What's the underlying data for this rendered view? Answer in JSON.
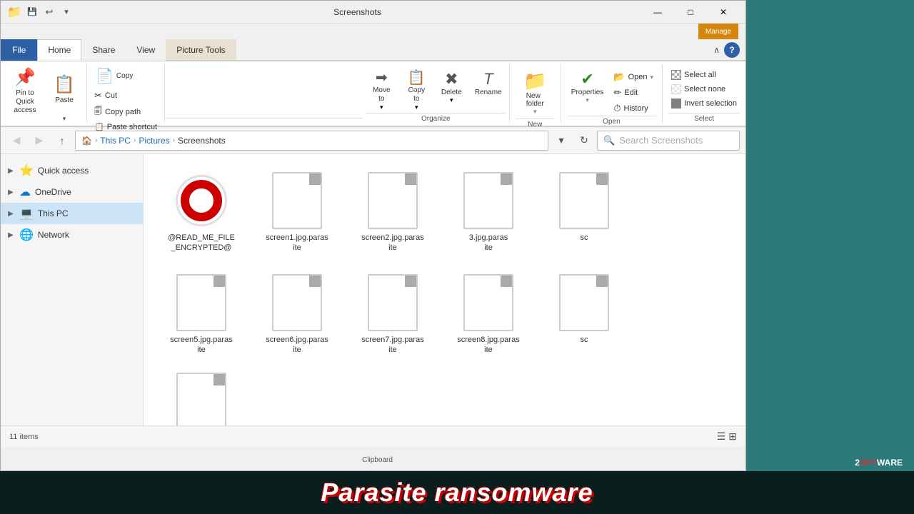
{
  "window": {
    "title": "Screenshots",
    "manage_label": "Manage",
    "picture_tools_label": "Picture Tools"
  },
  "titlebar": {
    "folder_icon": "📁",
    "quick_save_icon": "💾",
    "dropdown_label": "▾"
  },
  "window_controls": {
    "minimize": "—",
    "maximize": "□",
    "close": "✕"
  },
  "ribbon": {
    "tabs": {
      "file": "File",
      "home": "Home",
      "share": "Share",
      "view": "View",
      "picture_tools": "Picture Tools"
    },
    "groups": {
      "clipboard": {
        "label": "Clipboard",
        "pin_label": "Pin to Quick\naccess",
        "copy_label": "Copy",
        "paste_label": "Paste",
        "cut_label": "Cut",
        "copy_path_label": "Copy path",
        "paste_shortcut_label": "Paste shortcut"
      },
      "organize": {
        "label": "Organize",
        "move_to_label": "Move\nto",
        "copy_to_label": "Copy\nto",
        "delete_label": "Delete",
        "rename_label": "Rename"
      },
      "new": {
        "label": "New",
        "new_folder_label": "New\nfolder"
      },
      "open": {
        "label": "Open",
        "open_label": "Open",
        "edit_label": "Edit",
        "history_label": "History",
        "properties_label": "Properties"
      },
      "select": {
        "label": "Select",
        "select_all_label": "Select all",
        "select_none_label": "Select none",
        "invert_selection_label": "Invert selection"
      }
    }
  },
  "addressbar": {
    "back_icon": "◀",
    "forward_icon": "▶",
    "up_icon": "↑",
    "breadcrumb": {
      "home_icon": "🏠",
      "this_pc": "This PC",
      "pictures": "Pictures",
      "screenshots": "Screenshots"
    },
    "dropdown_icon": "▾",
    "refresh_icon": "↻",
    "search_placeholder": "Search Screenshots",
    "search_icon": "🔍"
  },
  "sidebar": {
    "items": [
      {
        "label": "Quick access",
        "icon": "⭐",
        "expand": "▶",
        "color": "folder"
      },
      {
        "label": "OneDrive",
        "icon": "☁",
        "expand": "▶",
        "color": "onedrive"
      },
      {
        "label": "This PC",
        "icon": "💻",
        "expand": "▶",
        "color": "thispc",
        "selected": true
      },
      {
        "label": "Network",
        "icon": "🌐",
        "expand": "▶",
        "color": "network"
      }
    ]
  },
  "files": [
    {
      "name": "@READ_ME_FILE\n_ENCRYPTED@",
      "type": "opera",
      "row": 1
    },
    {
      "name": "screen1.jpg.paras\nite",
      "type": "doc",
      "row": 1
    },
    {
      "name": "screen2.jpg.paras\nite",
      "type": "doc",
      "row": 1
    },
    {
      "name": "3.jpg.paras\nte",
      "type": "doc",
      "row": 1
    },
    {
      "name": "sc",
      "type": "doc",
      "row": 1
    },
    {
      "name": "screen5.jpg.paras\nite",
      "type": "doc",
      "row": 2
    },
    {
      "name": "screen6.jpg.paras\nite",
      "type": "doc",
      "row": 2
    },
    {
      "name": "screen7.jpg.paras\nite",
      "type": "doc",
      "row": 2
    },
    {
      "name": "screen8.jpg.paras\nite",
      "type": "doc",
      "row": 2
    },
    {
      "name": "sc",
      "type": "doc",
      "row": 2
    }
  ],
  "statusbar": {
    "item_count": "11 items"
  },
  "watermark": {
    "text": "Parasite ransomware"
  },
  "brand": {
    "text": "2SPYWARE",
    "spy": "SPY"
  }
}
